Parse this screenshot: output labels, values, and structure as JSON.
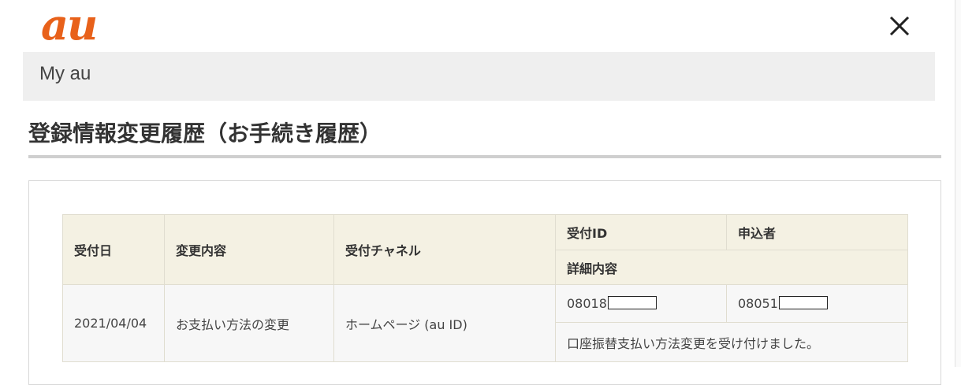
{
  "brand": {
    "logo_text": "au",
    "color": "#e8611a"
  },
  "header": {
    "close_icon": "close-icon"
  },
  "nav": {
    "label": "My au"
  },
  "page": {
    "title": "登録情報変更履歴（お手続き履歴）"
  },
  "table": {
    "headers": {
      "date": "受付日",
      "change": "変更内容",
      "channel": "受付チャネル",
      "reception_id": "受付ID",
      "applicant": "申込者",
      "details": "詳細内容"
    },
    "rows": [
      {
        "date": "2021/04/04",
        "change": "お支払い方法の変更",
        "channel": "ホームページ (au ID)",
        "reception_id_prefix": "08018",
        "applicant_prefix": "08051",
        "details": "口座振替支払い方法変更を受け付けました。"
      }
    ]
  }
}
